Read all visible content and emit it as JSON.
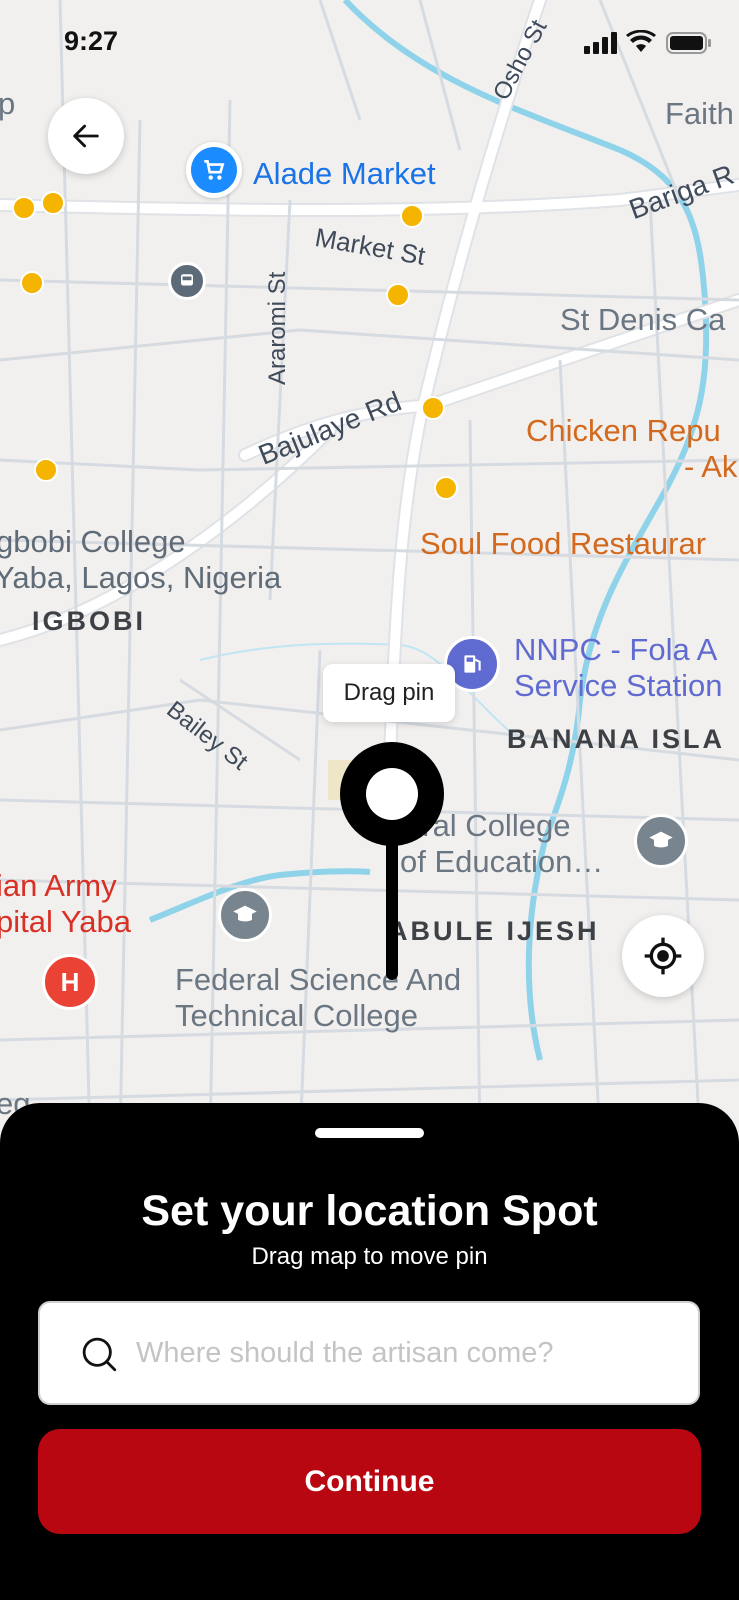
{
  "status_bar": {
    "time": "9:27"
  },
  "map": {
    "streets": {
      "osho": "Osho St",
      "bariga": "Bariga R",
      "market": "Market St",
      "araromi": "Araromi St",
      "bajulaye": "Bajulaye Rd",
      "bailey": "Bailey St"
    },
    "places": {
      "p_left": "p",
      "faith": "Faith",
      "alade": "Alade Market",
      "st_denis": "St Denis Ca",
      "chicken_line1": "Chicken Repu",
      "chicken_line2": "- Ak",
      "igbobi_line1": "gbobi College",
      "igbobi_line2": "Yaba, Lagos, Nigeria",
      "soul_food": "Soul Food Restaurar",
      "nnpc_line1": "NNPC - Fola A",
      "nnpc_line2": "Service Station",
      "fed_college_line1": "eral College",
      "fed_college_line2": "of Education…",
      "army_line1": "ian Army",
      "army_line2": "pital Yaba",
      "fed_science_line1": "Federal Science And",
      "fed_science_line2": "Technical College",
      "bottom_left": "eg"
    },
    "neighborhoods": {
      "igbobi": "IGBOBI",
      "banana": "BANANA ISLA",
      "abule": "ABULE IJESH"
    },
    "pin_tooltip": "Drag pin",
    "colors": {
      "water": "#8fd3ea",
      "road": "#ffffff",
      "road_outline": "#dfe2e6",
      "bus": "#f4b400",
      "market": "#1a8cff",
      "hospital": "#ea4335",
      "fuel": "#5f6bd1",
      "school": "#78858f"
    }
  },
  "sheet": {
    "title": "Set your location Spot",
    "subtitle": "Drag map to move pin",
    "search_placeholder": "Where should the artisan come?",
    "continue_label": "Continue",
    "accent_color": "#b80710"
  }
}
